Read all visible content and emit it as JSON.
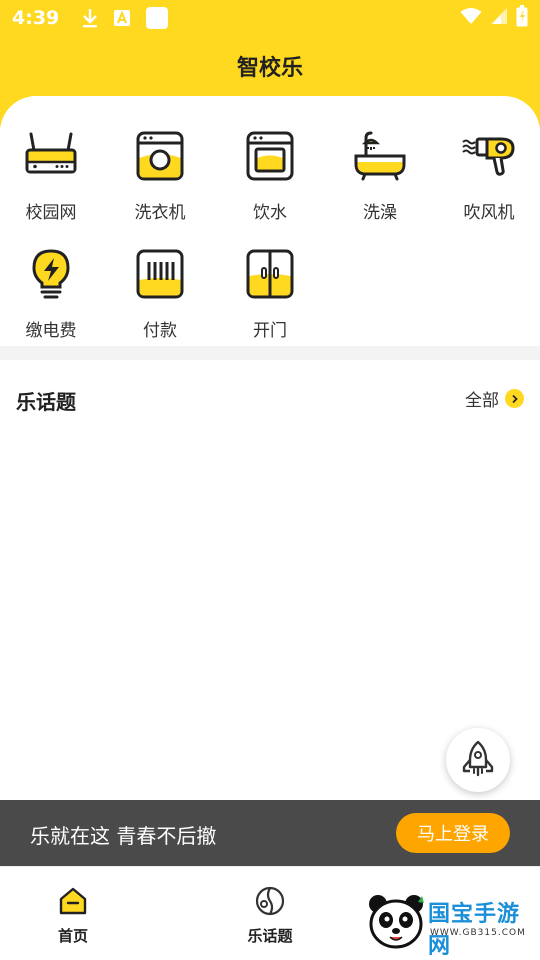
{
  "status_bar": {
    "time": "4:39"
  },
  "header": {
    "title": "智校乐"
  },
  "colors": {
    "accent": "#FFD91F",
    "button": "#FFA500",
    "login_bar": "#4A4A4A"
  },
  "services": [
    {
      "label": "校园网",
      "icon": "router-icon"
    },
    {
      "label": "洗衣机",
      "icon": "washing-machine-icon"
    },
    {
      "label": "饮水",
      "icon": "water-dispenser-icon"
    },
    {
      "label": "洗澡",
      "icon": "bathtub-icon"
    },
    {
      "label": "吹风机",
      "icon": "hair-dryer-icon"
    },
    {
      "label": "缴电费",
      "icon": "lightbulb-icon"
    },
    {
      "label": "付款",
      "icon": "payment-icon"
    },
    {
      "label": "开门",
      "icon": "door-icon"
    }
  ],
  "topics": {
    "title": "乐话题",
    "view_all": "全部"
  },
  "login_bar": {
    "slogan": "乐就在这 青春不后撤",
    "button": "马上登录"
  },
  "bottom_nav": [
    {
      "label": "首页",
      "icon": "home-icon"
    },
    {
      "label": "乐话题",
      "icon": "topic-icon"
    }
  ],
  "watermark": {
    "brand": "国宝手游网",
    "url": "WWW.GB315.COM"
  }
}
